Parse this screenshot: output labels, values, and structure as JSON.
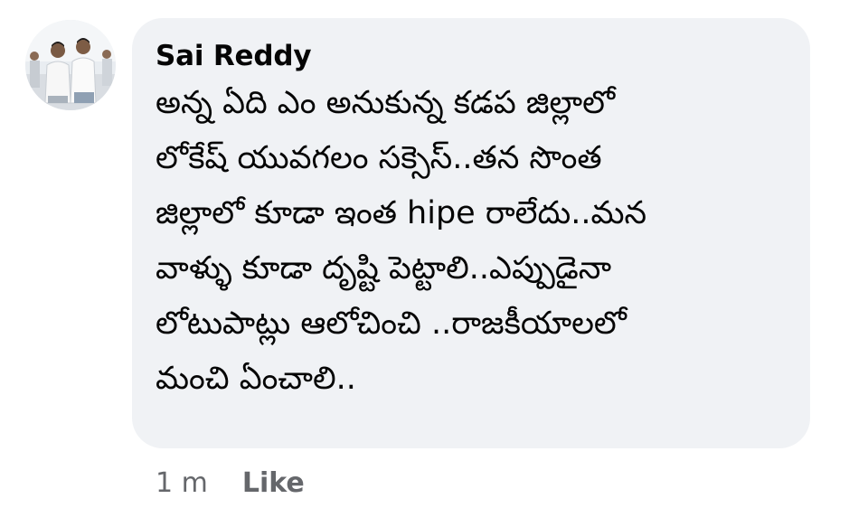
{
  "comment": {
    "author": "Sai Reddy",
    "lines": [
      "అన్న ఏది ఎం అనుకున్న కడప జిల్లాలో",
      "లోకేష్ యువగలం  సక్సెస్..తన సొంత",
      "జిల్లాలో కూడా ఇంత hipe రాలేదు..మన",
      "వాళ్ళు కూడా దృష్టి పెట్టాలి..ఎప్పుడైనా",
      "లోటుపాట్లు ఆలోచించి ..రాజకీయాలలో",
      "మంచి ఏంచాలి.."
    ],
    "timestamp": "1 m",
    "like_label": "Like"
  },
  "colors": {
    "bubble": "#f0f2f5",
    "author_text": "#050505",
    "meta_text": "#65676b"
  },
  "icons": {
    "avatar": "profile-photo-two-people"
  }
}
